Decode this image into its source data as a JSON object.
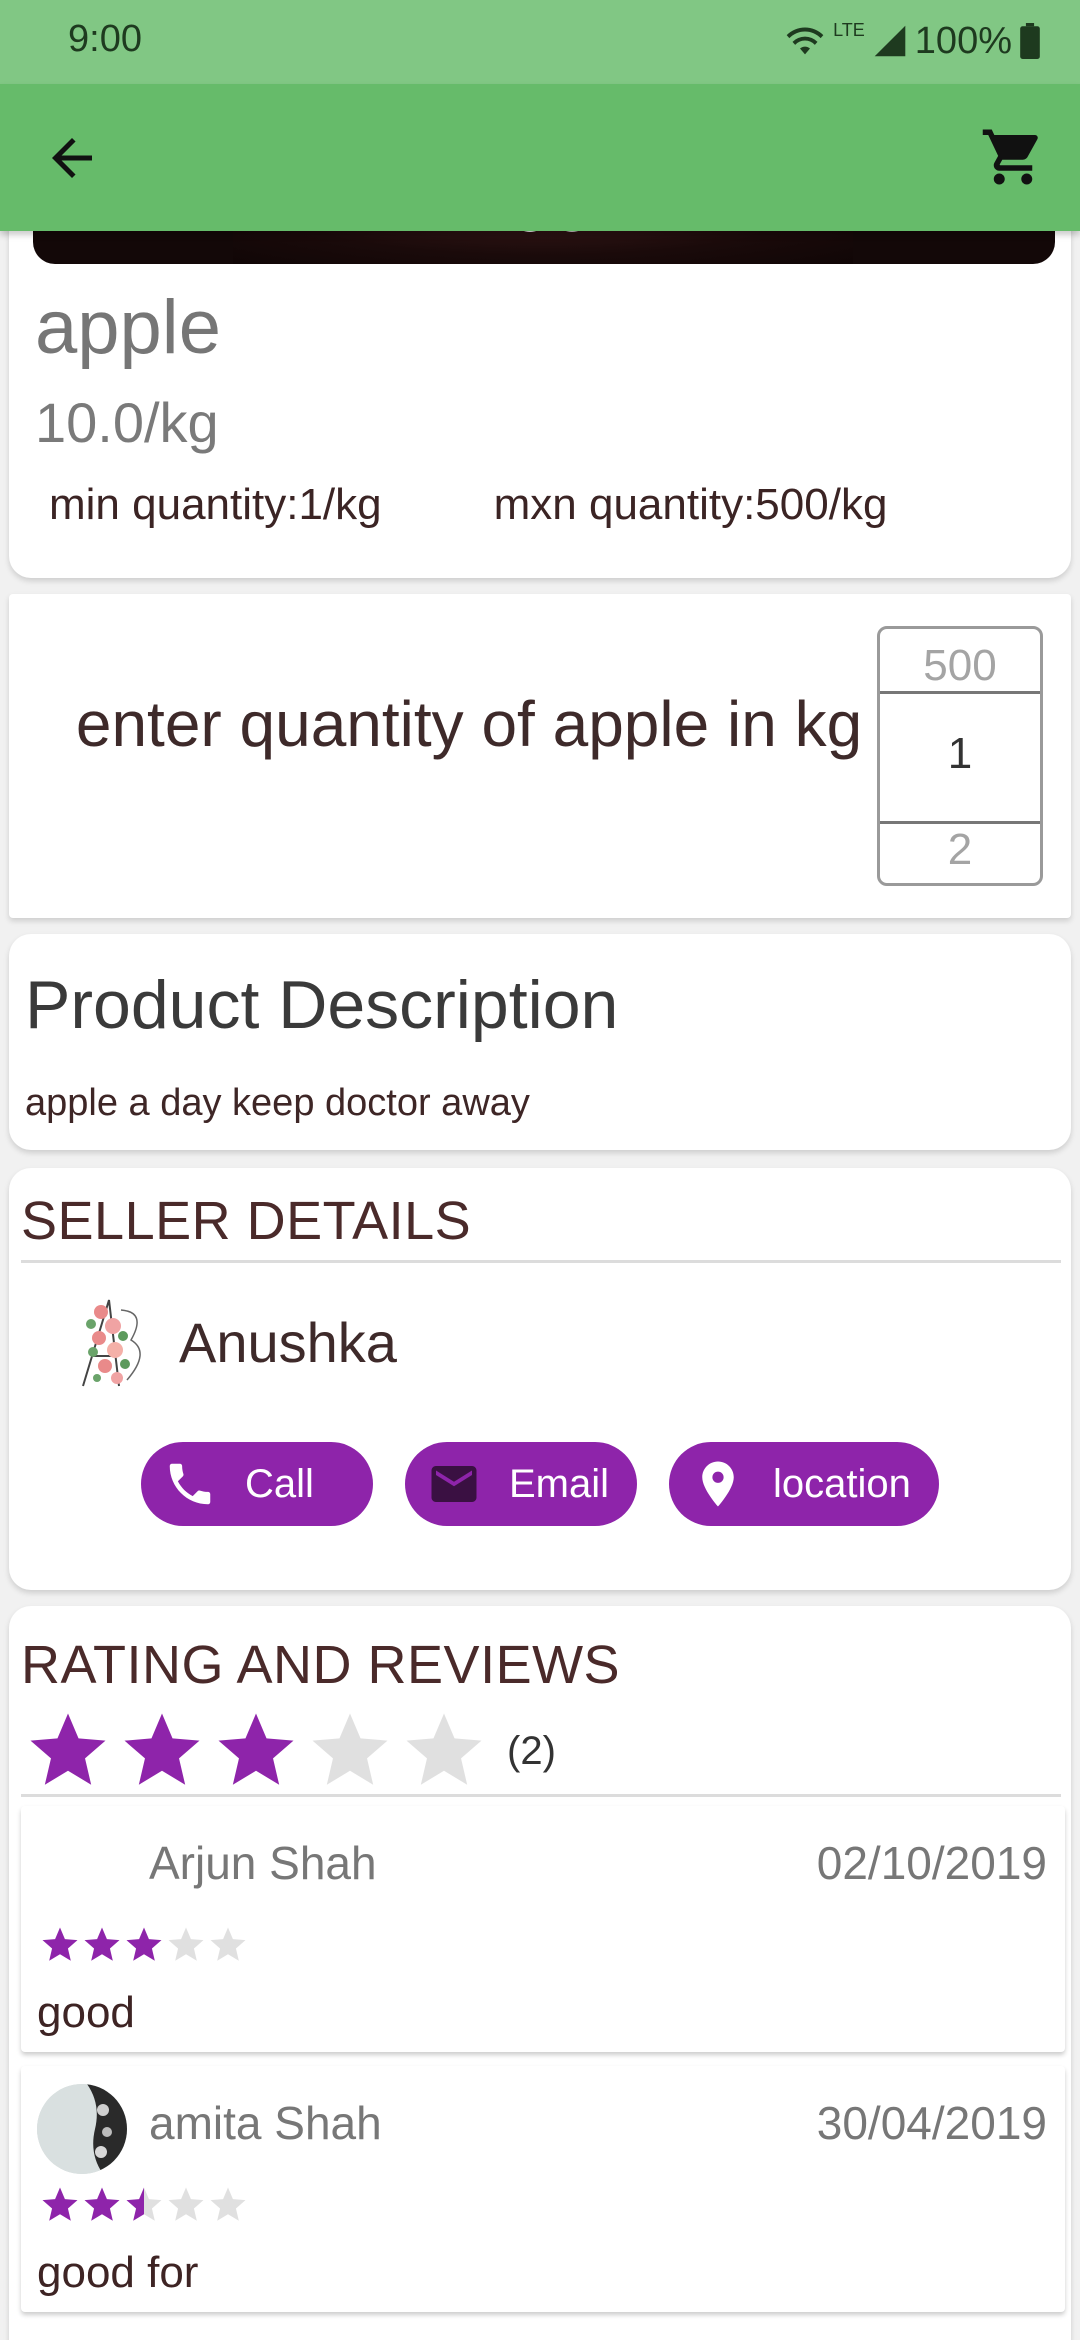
{
  "status_bar": {
    "time": "9:00",
    "network": "LTE",
    "battery": "100%"
  },
  "app_bar": {
    "back_icon": "arrow-back-icon",
    "cart_icon": "shopping-cart-icon"
  },
  "product": {
    "name": "apple",
    "price": "10.0/kg",
    "min_quantity": "min quantity:1/kg",
    "max_quantity": "mxn quantity:500/kg"
  },
  "quantity_picker": {
    "prompt": "enter quantity of apple in kg",
    "prev_value": "500",
    "current_value": "1",
    "next_value": "2"
  },
  "description": {
    "title": "Product Description",
    "text": "apple a day keep doctor away"
  },
  "seller": {
    "section_title": "SELLER DETAILS",
    "name": "Anushka",
    "call_label": "Call",
    "email_label": "Email",
    "location_label": "location"
  },
  "ratings": {
    "section_title": "RATING AND REVIEWS",
    "average": 3,
    "max": 5,
    "count_text": "(2)",
    "reviews": [
      {
        "name": "Arjun Shah",
        "date": "02/10/2019",
        "rating": 3,
        "text": "good"
      },
      {
        "name": "amita Shah",
        "date": "30/04/2019",
        "rating": 2.5,
        "text": "good for"
      }
    ]
  },
  "colors": {
    "status_bar": "#81c784",
    "app_bar": "#66bb6a",
    "accent": "#8e24aa",
    "star_empty": "#e0e0e0"
  }
}
